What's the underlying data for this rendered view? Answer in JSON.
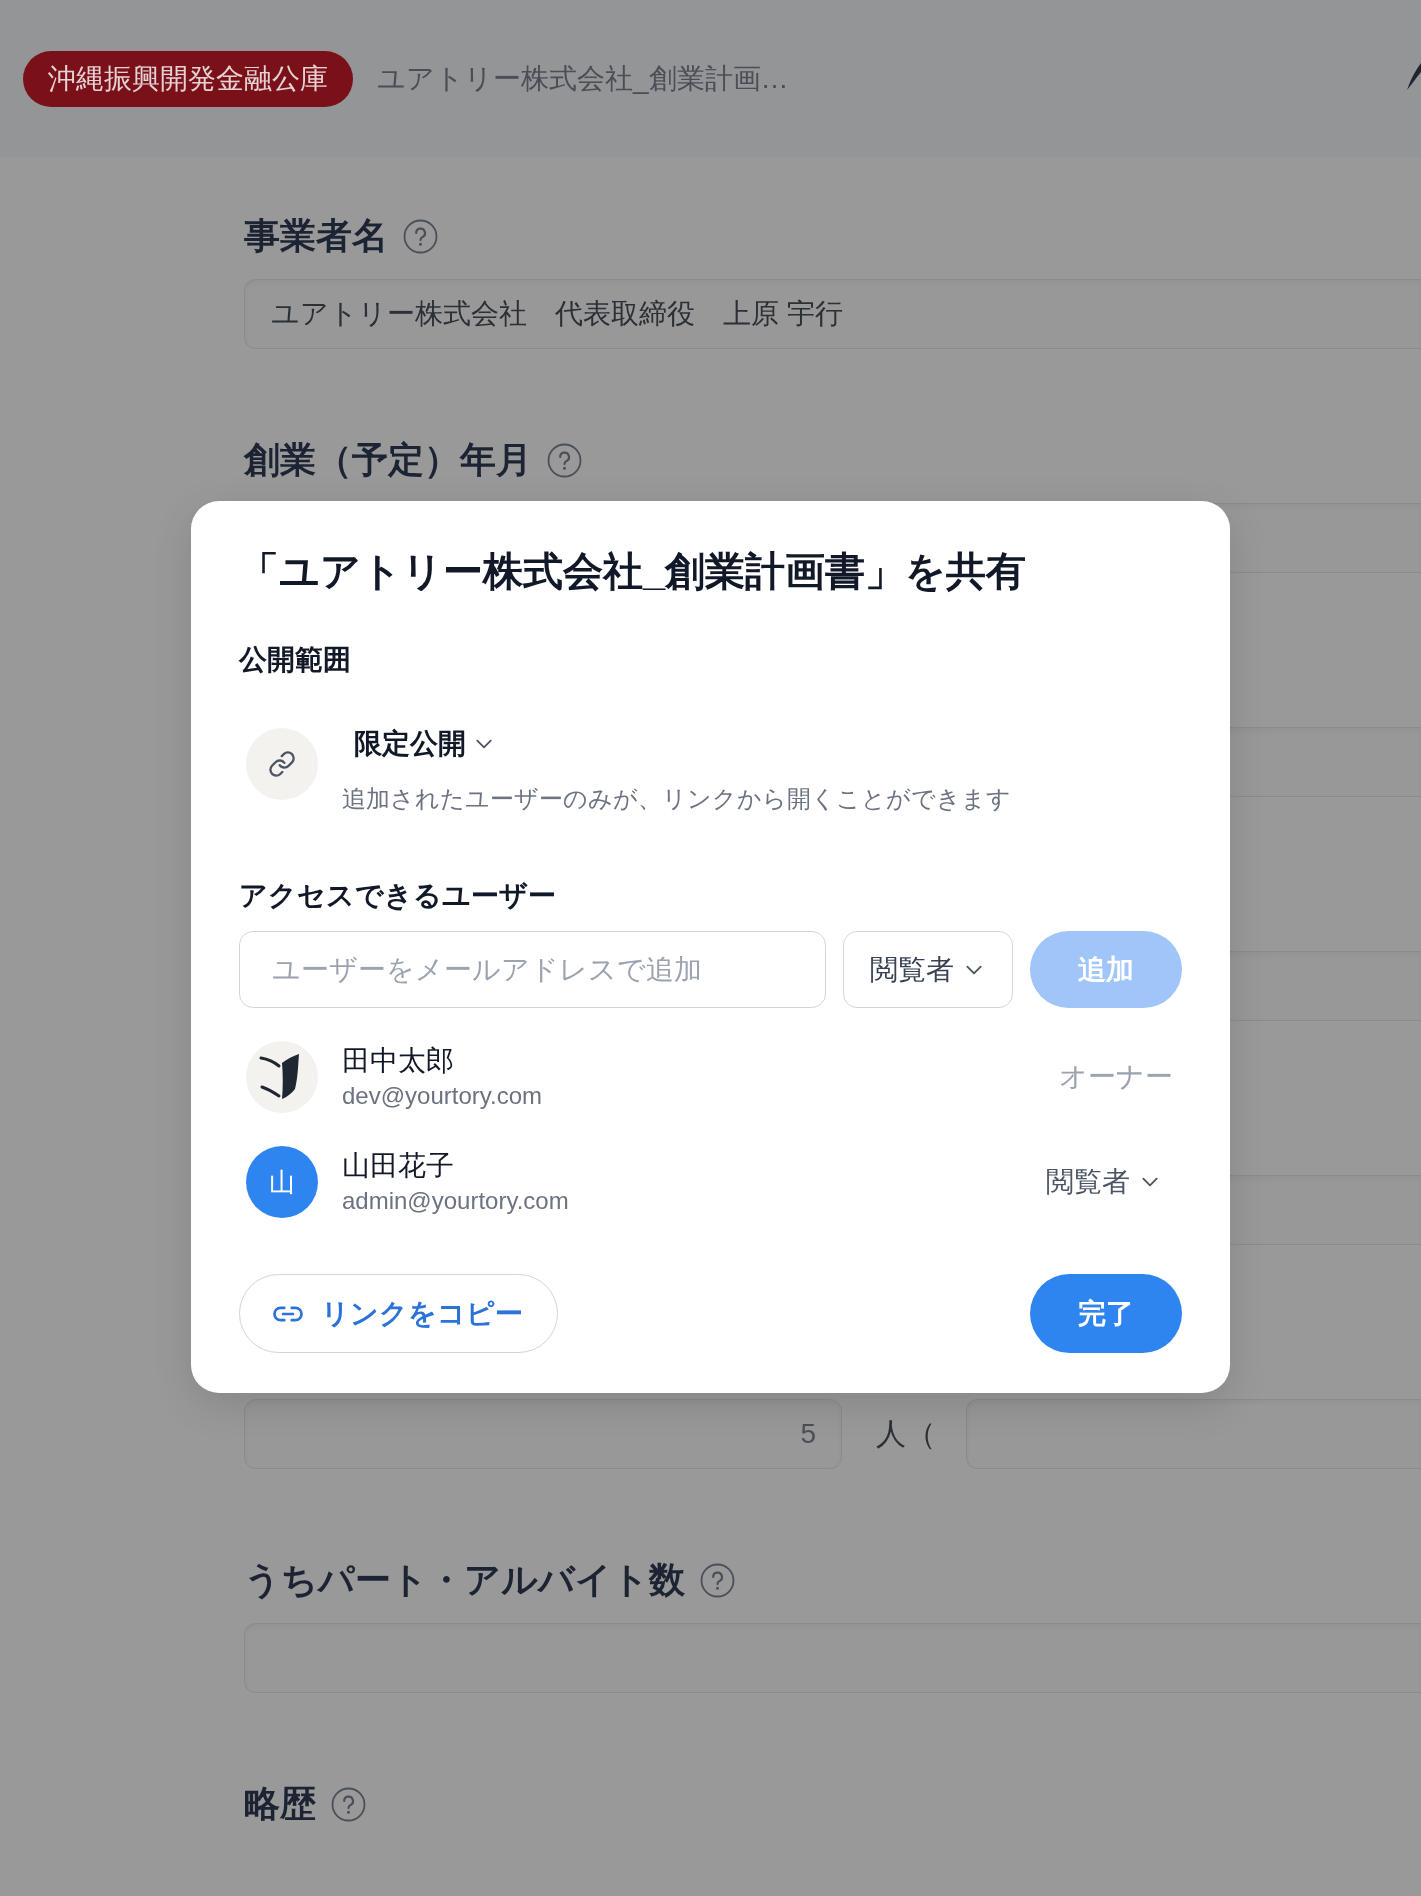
{
  "header": {
    "badge": "沖縄振興開発金融公庫",
    "breadcrumb": "ユアトリー株式会社_創業計画…"
  },
  "form": {
    "sections": [
      {
        "kind": "text",
        "label": "事業者名",
        "help": true,
        "value": "ユアトリー株式会社　代表取締役　上原 宇行"
      },
      {
        "kind": "text",
        "label": "創業（予定）年月",
        "help": true
      },
      {
        "kind": "text"
      },
      {
        "kind": "text"
      },
      {
        "kind": "text"
      },
      {
        "kind": "count",
        "value": "5",
        "unit": "人（"
      },
      {
        "kind": "text",
        "label": "うちパート・アルバイト数",
        "help": true
      },
      {
        "kind": "heading",
        "label": "略歴",
        "help": true
      }
    ]
  },
  "dialog": {
    "title": "「ユアトリー株式会社_創業計画書」を共有",
    "visibility": {
      "heading": "公開範囲",
      "option": "限定公開",
      "description": "追加されたユーザーのみが、リンクから開くことができます"
    },
    "access": {
      "heading": "アクセスできるユーザー",
      "email": {
        "placeholder": "ユーザーをメールアドレスで追加"
      },
      "role": "閲覧者",
      "add_button": {
        "label": "追加",
        "disabled": true
      }
    },
    "users": [
      {
        "name": "田中太郎",
        "email": "dev@yourtory.com",
        "avatar": {
          "kind": "logo"
        },
        "role": {
          "label": "オーナー",
          "editable": false
        }
      },
      {
        "name": "山田花子",
        "email": "admin@yourtory.com",
        "avatar": {
          "kind": "initial",
          "initial": "山"
        },
        "role": {
          "label": "閲覧者",
          "editable": true
        }
      }
    ],
    "copy_button": "リンクをコピー",
    "done_button": "完了"
  }
}
